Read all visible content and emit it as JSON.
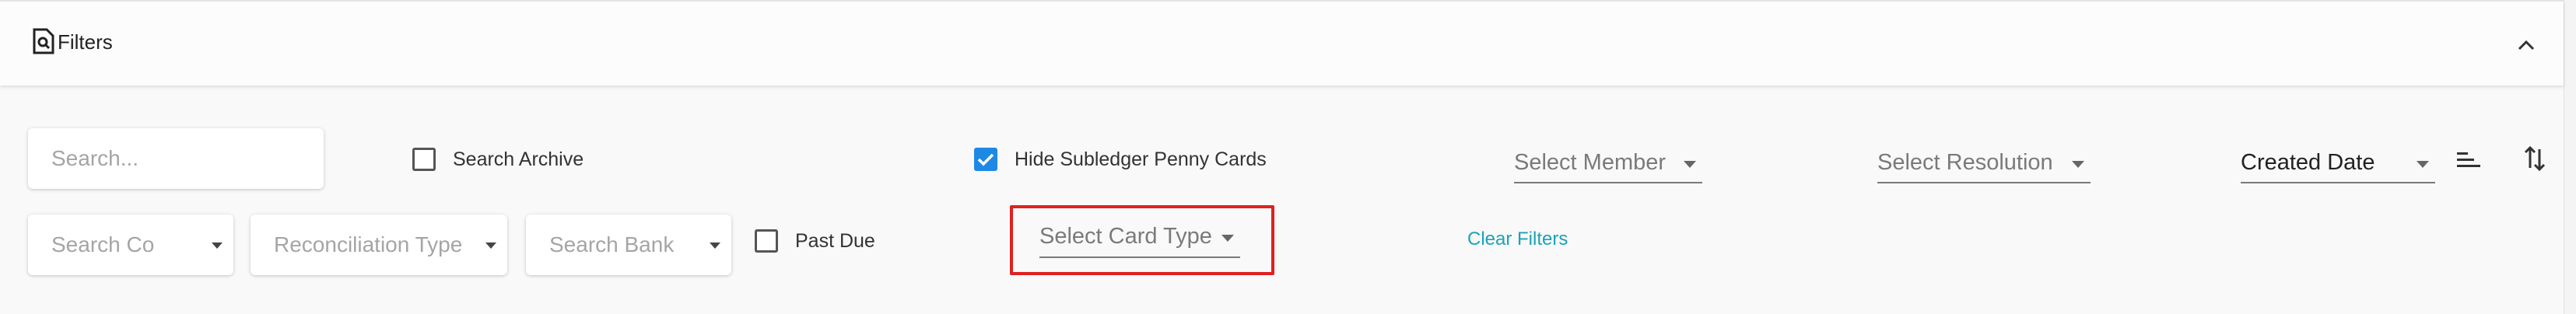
{
  "header": {
    "title": "Filters",
    "filter_icon": "filter-doc-icon",
    "collapse_icon": "chevron-up-icon"
  },
  "row1": {
    "search": {
      "placeholder": "Search..."
    },
    "search_archive": {
      "label": "Search Archive",
      "checked": false
    },
    "hide_subledger": {
      "label": "Hide Subledger Penny Cards",
      "checked": true
    },
    "select_member": {
      "placeholder": "Select Member"
    },
    "select_resolution": {
      "placeholder": "Select Resolution"
    },
    "sort_by": {
      "value": "Created Date"
    },
    "sort_lines_icon": "sort-lines-icon",
    "sort_direction_icon": "sort-direction-icon"
  },
  "row2": {
    "search_co": {
      "placeholder": "Search Co"
    },
    "reconciliation_type": {
      "placeholder": "Reconciliation Type"
    },
    "search_bank": {
      "placeholder": "Search Bank"
    },
    "past_due": {
      "label": "Past Due",
      "checked": false
    },
    "select_card_type": {
      "placeholder": "Select Card Type"
    },
    "clear_filters": {
      "label": "Clear Filters"
    }
  },
  "colors": {
    "accent": "#1e88e5",
    "link": "#1aa3b8",
    "highlight": "#e02020"
  }
}
